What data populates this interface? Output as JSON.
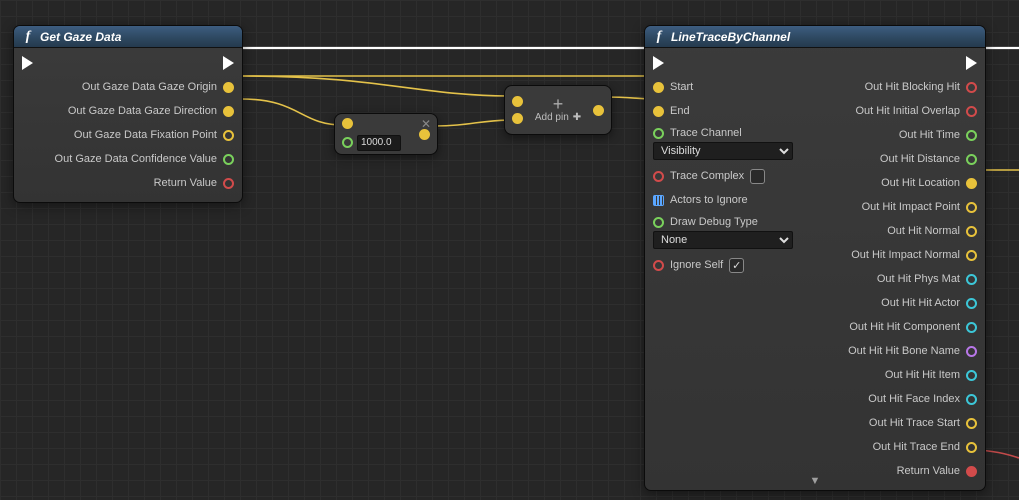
{
  "gaze": {
    "title": "Get Gaze Data",
    "out": {
      "origin": "Out Gaze Data Gaze Origin",
      "direction": "Out Gaze Data Gaze Direction",
      "fixation": "Out Gaze Data Fixation Point",
      "confidence": "Out Gaze Data Confidence Value",
      "return": "Return Value"
    }
  },
  "mult": {
    "value": "1000.0"
  },
  "addpin": {
    "label": "Add pin"
  },
  "trace": {
    "title": "LineTraceByChannel",
    "in": {
      "start": "Start",
      "end": "End",
      "channel_label": "Trace Channel",
      "channel_value": "Visibility",
      "complex": "Trace Complex",
      "ignore_actors": "Actors to Ignore",
      "debug_label": "Draw Debug Type",
      "debug_value": "None",
      "ignore_self": "Ignore Self",
      "ignore_self_checked": "✓"
    },
    "out": {
      "blocking": "Out Hit Blocking Hit",
      "overlap": "Out Hit Initial Overlap",
      "time": "Out Hit Time",
      "distance": "Out Hit Distance",
      "location": "Out Hit Location",
      "impact_point": "Out Hit Impact Point",
      "normal": "Out Hit Normal",
      "impact_normal": "Out Hit Impact Normal",
      "phys_mat": "Out Hit Phys Mat",
      "hit_actor": "Out Hit Hit Actor",
      "hit_component": "Out Hit Hit Component",
      "bone_name": "Out Hit Hit Bone Name",
      "hit_item": "Out Hit Hit Item",
      "face_index": "Out Hit Face Index",
      "trace_start": "Out Hit Trace Start",
      "trace_end": "Out Hit Trace End",
      "return": "Return Value"
    }
  }
}
